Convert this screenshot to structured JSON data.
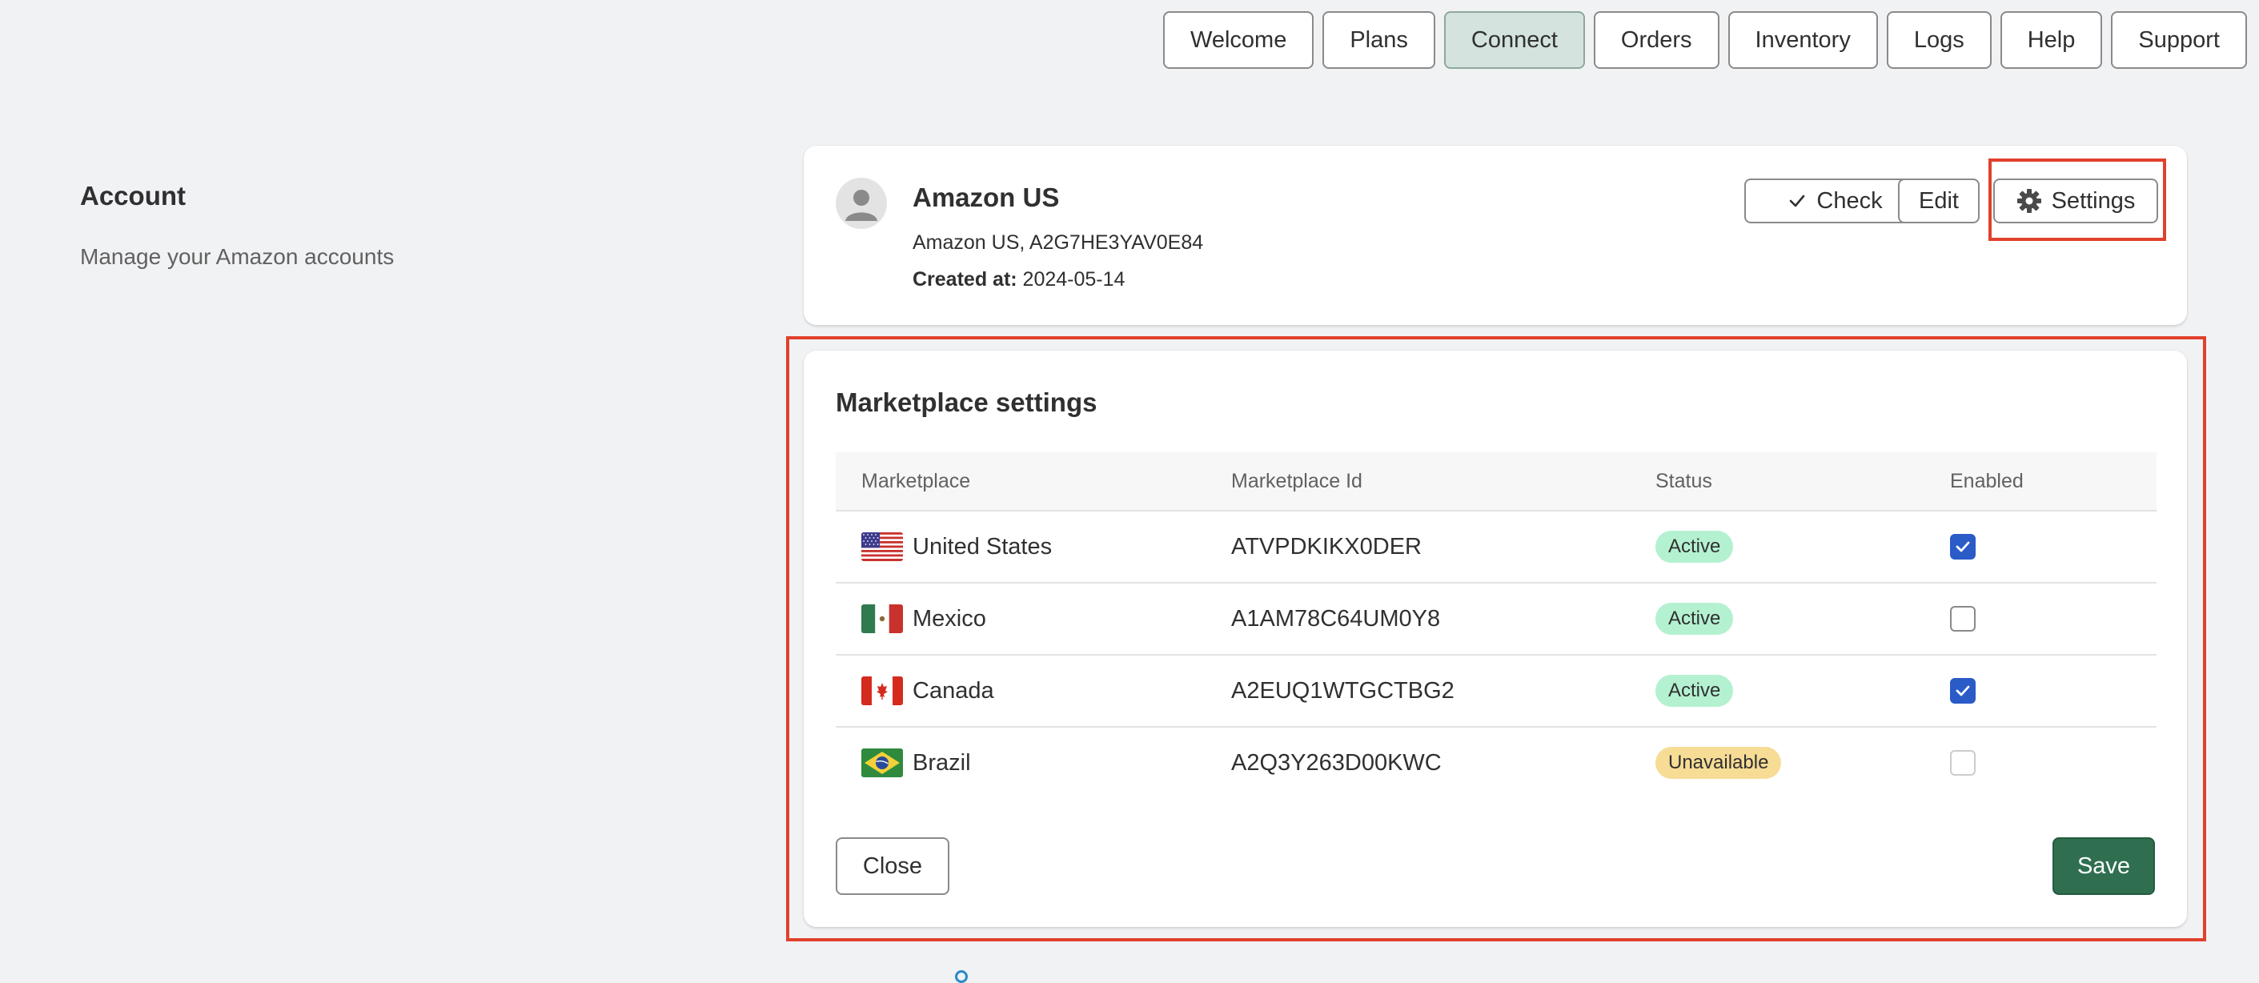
{
  "nav": {
    "items": [
      {
        "label": "Welcome"
      },
      {
        "label": "Plans"
      },
      {
        "label": "Connect"
      },
      {
        "label": "Orders"
      },
      {
        "label": "Inventory"
      },
      {
        "label": "Logs"
      },
      {
        "label": "Help"
      },
      {
        "label": "Support"
      }
    ],
    "active": "Connect"
  },
  "section": {
    "title": "Account",
    "description": "Manage your Amazon accounts"
  },
  "account": {
    "name": "Amazon US",
    "subtitle": "Amazon US, A2G7HE3YAV0E84",
    "created_label": "Created at:",
    "created_value": "2024-05-14",
    "check_label": "Check",
    "edit_label": "Edit",
    "settings_label": "Settings"
  },
  "marketplace": {
    "title": "Marketplace settings",
    "columns": [
      "Marketplace",
      "Marketplace Id",
      "Status",
      "Enabled"
    ],
    "rows": [
      {
        "name": "United States",
        "flag": "us-flag-icon",
        "id": "ATVPDKIKX0DER",
        "status": "Active",
        "enabled": true
      },
      {
        "name": "Mexico",
        "flag": "mx-flag-icon",
        "id": "A1AM78C64UM0Y8",
        "status": "Active",
        "enabled": false
      },
      {
        "name": "Canada",
        "flag": "ca-flag-icon",
        "id": "A2EUQ1WTGCTBG2",
        "status": "Active",
        "enabled": true
      },
      {
        "name": "Brazil",
        "flag": "br-flag-icon",
        "id": "A2Q3Y263D00KWC",
        "status": "Unavailable",
        "enabled": false
      }
    ],
    "close_label": "Close",
    "save_label": "Save"
  },
  "colors": {
    "primary": "#2f6f4f",
    "highlight": "#e0412c",
    "checkbox": "#2a5bc7",
    "active_badge": "#b4f1d1",
    "unavailable_badge": "#f7dc96"
  }
}
